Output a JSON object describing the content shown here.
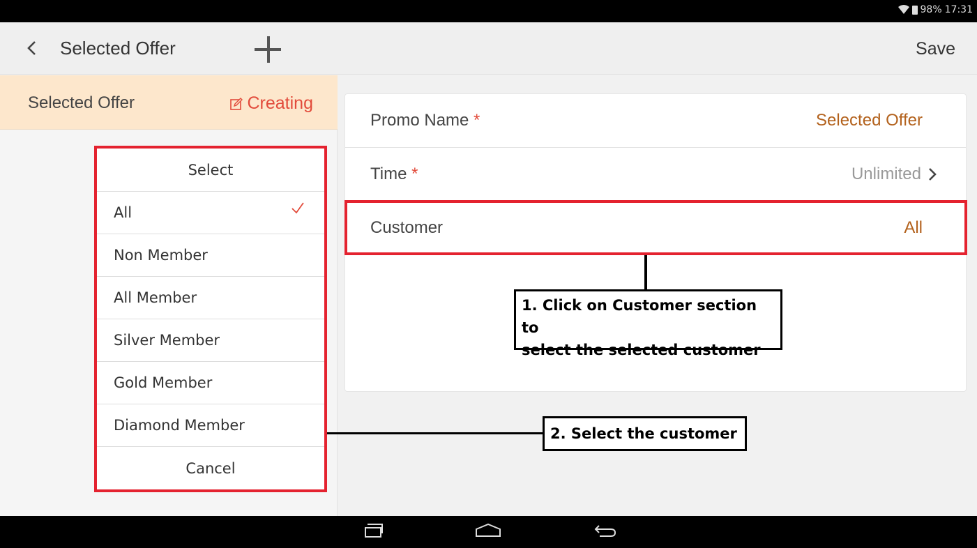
{
  "status_bar": {
    "battery": "98%",
    "time": "17:31"
  },
  "app_bar": {
    "title": "Selected Offer",
    "save_label": "Save"
  },
  "offer_header": {
    "name": "Selected Offer",
    "status": "Creating"
  },
  "select_dialog": {
    "title": "Select",
    "options": [
      "All",
      "Non Member",
      "All Member",
      "Silver Member",
      "Gold Member",
      "Diamond Member"
    ],
    "selected": "All",
    "cancel_label": "Cancel"
  },
  "form": {
    "promo_name": {
      "label": "Promo Name",
      "required_mark": "*",
      "value": "Selected Offer"
    },
    "time": {
      "label": "Time",
      "required_mark": "*",
      "value": "Unlimited"
    },
    "customer": {
      "label": "Customer",
      "value": "All"
    }
  },
  "annotations": {
    "step1_line1": "1. Click on Customer section to",
    "step1_line2": "select the selected customer",
    "step2": "2. Select the customer"
  },
  "colors": {
    "accent_red": "#e24b3b",
    "value_brown": "#b3621d",
    "highlight": "#e4222f",
    "offer_header_bg": "#fde7cc"
  }
}
